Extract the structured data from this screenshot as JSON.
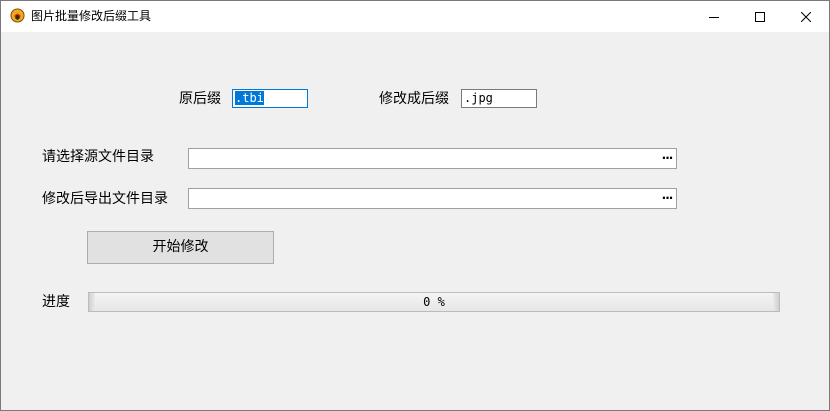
{
  "window": {
    "title": "图片批量修改后缀工具",
    "controls": {
      "minimize_icon": "minimize-icon",
      "maximize_icon": "maximize-icon",
      "close_icon": "close-icon"
    }
  },
  "form": {
    "original_suffix_label": "原后缀",
    "original_suffix_value": ".tbi",
    "new_suffix_label": "修改成后缀",
    "new_suffix_value": ".jpg",
    "source_dir_label": "请选择源文件目录",
    "source_dir_value": "",
    "output_dir_label": "修改后导出文件目录",
    "output_dir_value": "",
    "browse_label": "···",
    "start_button_label": "开始修改",
    "progress_label": "进度",
    "progress_value": 0,
    "progress_text": "0 %"
  },
  "colors": {
    "selection": "#0078d7",
    "window_bg": "#f0f0f0",
    "progress_fill": "#06b025"
  }
}
